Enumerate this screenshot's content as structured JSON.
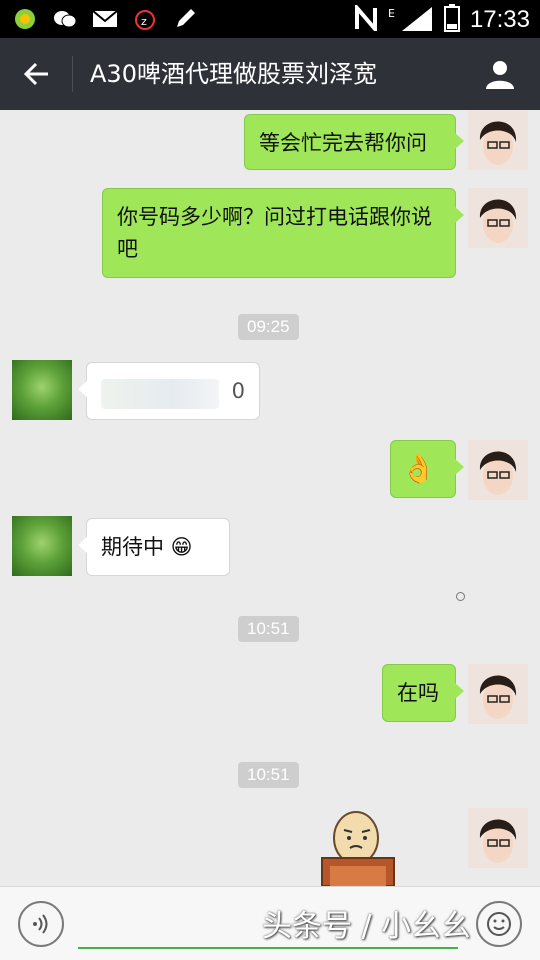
{
  "status_bar": {
    "time": "17:33",
    "icons": [
      "app-icon",
      "wechat-icon",
      "mail-icon",
      "alarm-icon",
      "pen-icon",
      "nfc-icon",
      "signal-icon",
      "battery-icon"
    ],
    "battery_level": "12"
  },
  "header": {
    "title": "A30啤酒代理做股票刘泽宽",
    "back_icon": "arrow-left-icon",
    "profile_icon": "person-icon"
  },
  "messages": [
    {
      "from": "me",
      "type": "text",
      "text": "等会忙完去帮你问"
    },
    {
      "from": "me",
      "type": "text",
      "text": "你号码多少啊？问过打电话跟你说吧"
    },
    {
      "type": "time",
      "text": "09:25"
    },
    {
      "from": "other",
      "type": "text",
      "text": "0"
    },
    {
      "from": "me",
      "type": "emoji",
      "text": "👌"
    },
    {
      "from": "other",
      "type": "text",
      "text": "期待中 😁"
    },
    {
      "type": "time",
      "text": "10:51"
    },
    {
      "from": "me",
      "type": "text",
      "text": "在吗"
    },
    {
      "type": "time",
      "text": "10:51"
    },
    {
      "from": "me",
      "type": "sticker",
      "text": ""
    }
  ],
  "input_bar": {
    "watermark": "头条号 / 小幺幺",
    "voice_icon": "voice-icon",
    "emoji_icon": "emoji-icon"
  },
  "colors": {
    "titlebar": "#2e3238",
    "bubble_me": "#9fe658",
    "bubble_other": "#ffffff",
    "chat_bg": "#ebebeb"
  }
}
